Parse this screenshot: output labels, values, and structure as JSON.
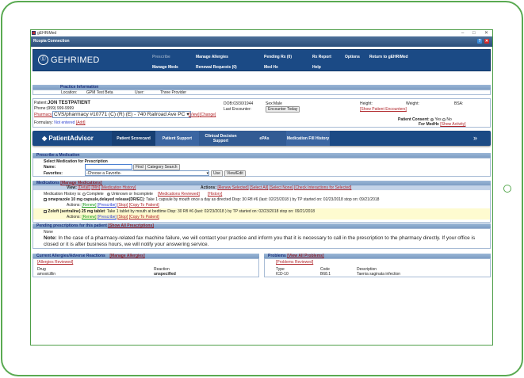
{
  "window": {
    "title": "gEHRiMed",
    "minimize": "–",
    "maximize": "□",
    "close": "✕"
  },
  "rcopia": {
    "title": "Rcopia Connection",
    "help_icon": "?",
    "close_icon": "✕"
  },
  "brand": {
    "logo": "GEHRIMED",
    "logo_mark": "ⓖ"
  },
  "nav": {
    "row1": [
      "Prescribe",
      "Manage Allergies",
      "Pending Rx (0)",
      "Rx Report",
      "Options",
      "Return to gEHRiMed"
    ],
    "row2": [
      "Manage Meds",
      "Renewal Requests (0)",
      "Med Hx",
      "Help"
    ]
  },
  "practice": {
    "title": "Practice Information",
    "location_label": "Location:",
    "location": "GPM Test Beta",
    "user_label": "User:",
    "user": "Three Provider"
  },
  "patient": {
    "name_label": "Patient:",
    "name": "JON TESTPATIENT",
    "phone_label": "Phone:",
    "phone": "(999) 999-9999",
    "dob_label": "DOB:",
    "dob": "03/30/1944",
    "sex_label": "Sex:",
    "sex": "Male",
    "height_label": "Height:",
    "weight_label": "Weight:",
    "bsa_label": "BSA:",
    "last_encounter_label": "Last Encounter:",
    "encounter_button": "Encounter Today",
    "show_encounters": "[Show Patient Encounters]",
    "pharmacy_label": "Pharmacy:",
    "pharmacy": "CVS/pharmacy #10771 (C) (R) (E) - 740 Railroad Ave PC",
    "view": "[View]",
    "change": "[Change]",
    "formulary_label": "Formulary:",
    "formulary": "Not entered",
    "add": "[Add]",
    "consent_label": "Patient Consent:",
    "consent_yes": "Yes",
    "consent_no": "No",
    "for_medhx": "For MedHx",
    "show_activity": "[Show Activity]"
  },
  "patient_advisor": {
    "logo": "PatientAdvisor",
    "tabs": [
      "Patient Scorecard",
      "Patient Support",
      "Clinical Decision Support",
      "ePAs",
      "Medication Fill History"
    ],
    "expand_icon": "»"
  },
  "prescribe": {
    "title": "Prescribe a Medication",
    "subtitle": "Select Medication for Prescription",
    "name_label": "Name:",
    "name_value": "",
    "find": "Find",
    "category_search": "Category Search",
    "favorites_label": "Favorites:",
    "favorites_value": "-Choose a Favorite-",
    "use": "Use",
    "view_edit": "View/Edit"
  },
  "medications": {
    "title": "Medications",
    "manage": "[Manage Medications]",
    "view_label": "View:",
    "view_links": [
      "[Detail]",
      "[Min]",
      "[Medication History]"
    ],
    "actions_label": "Actions:",
    "action_links": [
      "[Renew Selected]",
      "[Select All]",
      "[Select None]",
      "[Check Interactions for Selected]"
    ],
    "history_label": "Medication History is:",
    "complete": "Complete",
    "unknown": "Unknown or Incomplete",
    "reviewed": "[Medications Reviewed]",
    "history": "[History]",
    "items": [
      {
        "name": "omeprazole 10 mg capsule,delayed release(DR/EC)",
        "sig": ": Take 1 capsule by mouth once a day as directed Disp: 30 Rfl #6 (last: 02/23/2018 ) by TP started on: 02/23/2018 stop on: 09/21/2018"
      },
      {
        "name": "Zoloft (sertraline) 25 mg tablet",
        "sig": ": Take 1 tablet by mouth at bedtime Disp: 30 Rfl #6 (last: 02/23/2018 ) by TP started on: 02/23/2018 stop on: 09/21/2018"
      }
    ],
    "item_actions_label": "Actions:",
    "renew": "[Renew]",
    "prescribe": "[Prescribe]",
    "stop": "[Stop]",
    "copy": "[Copy To Patient]"
  },
  "pending": {
    "title": "Pending prescriptions for this patient",
    "show_all": "[Show All Prescriptions]",
    "none": "None",
    "note_label": "Note:",
    "note": "In the case of a pharmacy-related fax machine failure, we will contact your practice and inform you that it is necessary to call in the prescription to the pharmacy directly. If your office is closed or it is after business hours, we will notify your answering service."
  },
  "allergies": {
    "title": "Current Allergies/Adverse Reactions",
    "manage": "[Manage Allergies]",
    "reviewed": "[Allergies Reviewed]",
    "columns": [
      "Drug",
      "Reaction"
    ],
    "rows": [
      [
        "amoxicillin",
        "unspecified"
      ]
    ]
  },
  "problems": {
    "title": "Problems",
    "view_all": "[View All Problems]",
    "reviewed": "[Problems Reviewed]",
    "columns": [
      "Type",
      "Code",
      "Description"
    ],
    "rows": [
      [
        "ICD-10",
        "B68.1",
        "Taenia saginata infection"
      ]
    ]
  }
}
